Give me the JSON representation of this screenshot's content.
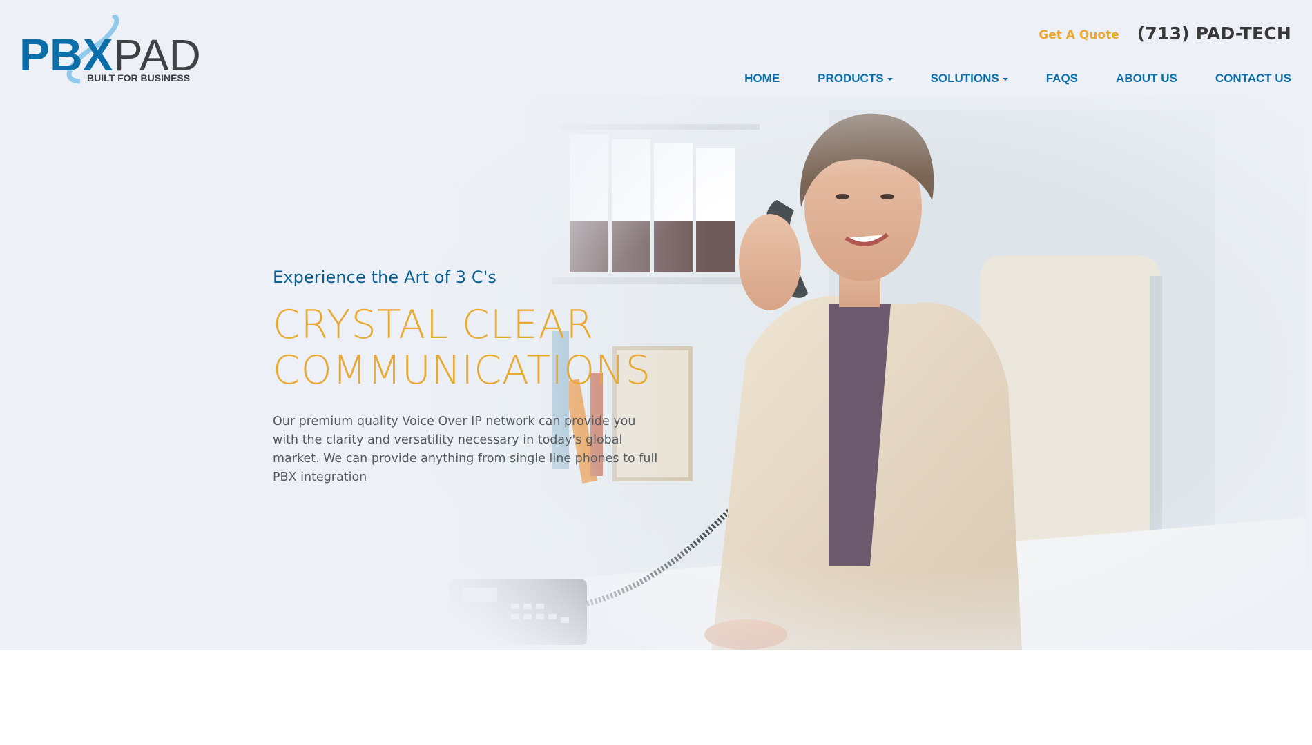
{
  "header": {
    "logo": {
      "brand_primary": "PBX",
      "brand_secondary": "PAD",
      "tagline": "BUILT FOR BUSINESS"
    },
    "quote_label": "Get A Quote",
    "phone": "(713) PAD-TECH"
  },
  "nav": {
    "items": [
      {
        "label": "HOME",
        "dropdown": false
      },
      {
        "label": "PRODUCTS",
        "dropdown": true
      },
      {
        "label": "SOLUTIONS",
        "dropdown": true
      },
      {
        "label": "FAQS",
        "dropdown": false
      },
      {
        "label": "ABOUT US",
        "dropdown": false
      },
      {
        "label": "CONTACT US",
        "dropdown": false
      }
    ]
  },
  "hero": {
    "tagline": "Experience the Art of 3 C's",
    "headline_line1": "CRYSTAL CLEAR",
    "headline_line2": "COMMUNICATIONS",
    "body": "Our premium quality Voice Over IP network can provide you with the clarity and versatility necessary in today's global market. We can provide anything from single line phones to full PBX integration"
  },
  "colors": {
    "accent": "#e9a930",
    "brand_blue": "#0c6ea8",
    "hero_background": "#edf1f7",
    "phone_text": "#383838"
  },
  "icons": {
    "dropdown": "caret-down-icon"
  }
}
